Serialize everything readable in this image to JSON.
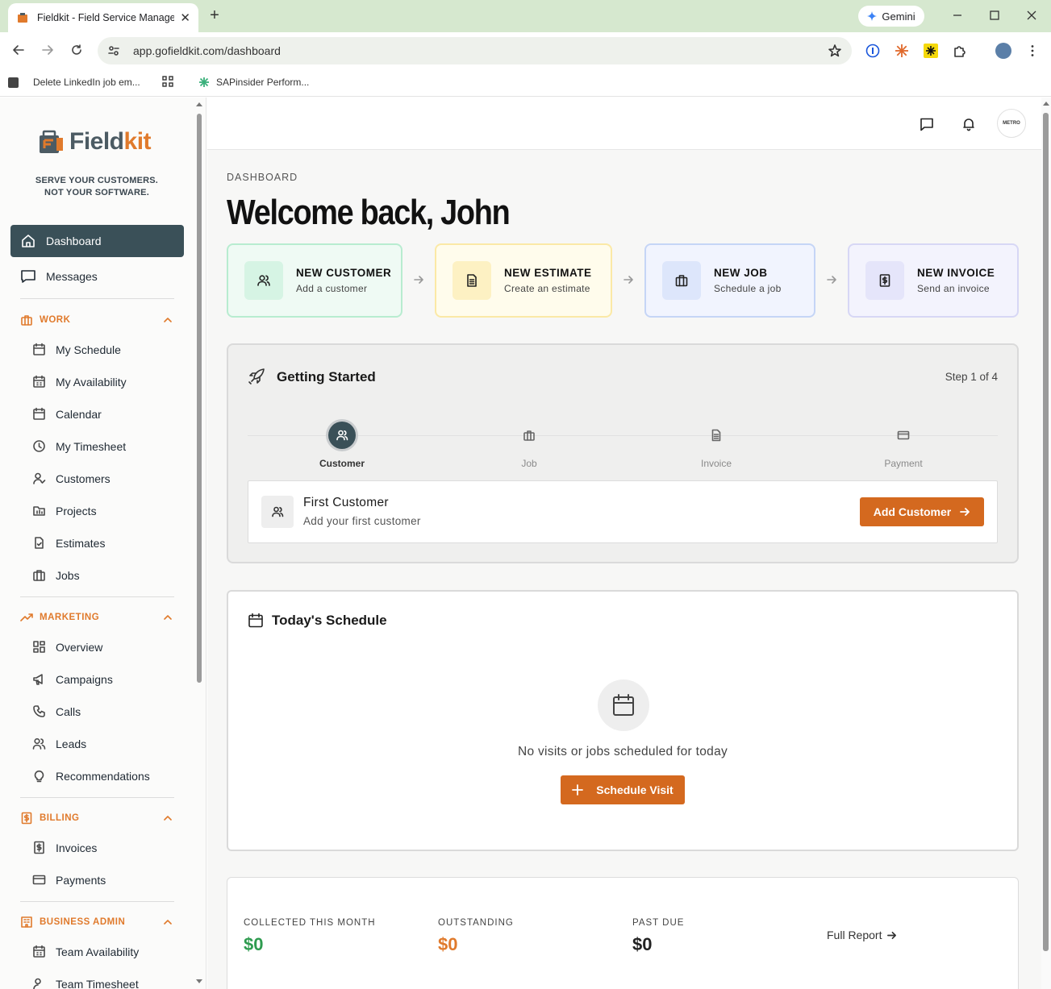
{
  "browser": {
    "tab_title": "Fieldkit - Field Service Managem",
    "tab_close": "✕",
    "new_tab": "+",
    "gemini": "Gemini",
    "url": "app.gofieldkit.com/dashboard",
    "bookmarks": [
      "Delete LinkedIn job em...",
      "SAPinsider Perform..."
    ]
  },
  "sidebar": {
    "brand_part1": "Field",
    "brand_part2": "kit",
    "tagline_line1": "SERVE YOUR CUSTOMERS.",
    "tagline_line2": "NOT YOUR SOFTWARE.",
    "top_items": [
      "Dashboard",
      "Messages"
    ],
    "sections": {
      "work": {
        "title": "WORK",
        "items": [
          "My Schedule",
          "My Availability",
          "Calendar",
          "My Timesheet",
          "Customers",
          "Projects",
          "Estimates",
          "Jobs"
        ]
      },
      "marketing": {
        "title": "MARKETING",
        "items": [
          "Overview",
          "Campaigns",
          "Calls",
          "Leads",
          "Recommendations"
        ]
      },
      "billing": {
        "title": "BILLING",
        "items": [
          "Invoices",
          "Payments"
        ]
      },
      "admin": {
        "title": "BUSINESS ADMIN",
        "items": [
          "Team Availability",
          "Team Timesheet"
        ]
      }
    }
  },
  "header": {
    "avatar_text": "METRO"
  },
  "dashboard": {
    "breadcrumb": "DASHBOARD",
    "welcome": "Welcome back, John",
    "quick_actions": [
      {
        "title": "NEW CUSTOMER",
        "subtitle": "Add a customer"
      },
      {
        "title": "NEW ESTIMATE",
        "subtitle": "Create an estimate"
      },
      {
        "title": "NEW JOB",
        "subtitle": "Schedule a job"
      },
      {
        "title": "NEW INVOICE",
        "subtitle": "Send an invoice"
      }
    ],
    "getting_started": {
      "title": "Getting Started",
      "step_text": "Step 1 of 4",
      "steps": [
        "Customer",
        "Job",
        "Invoice",
        "Payment"
      ],
      "task_title": "First Customer",
      "task_subtitle": "Add your first customer",
      "task_button": "Add Customer"
    },
    "schedule": {
      "title": "Today's Schedule",
      "empty_text": "No visits or jobs scheduled for today",
      "button": "Schedule Visit"
    },
    "finance": [
      {
        "label": "COLLECTED THIS MONTH",
        "value": "$0",
        "color": "#2e9b4f"
      },
      {
        "label": "OUTSTANDING",
        "value": "$0",
        "color": "#e07a2c"
      },
      {
        "label": "PAST DUE",
        "value": "$0",
        "color": "#222222"
      }
    ],
    "full_report": "Full Report"
  },
  "colors": {
    "accent": "#d4691f",
    "nav_active": "#3a5058",
    "brand_orange": "#e07a2c"
  }
}
